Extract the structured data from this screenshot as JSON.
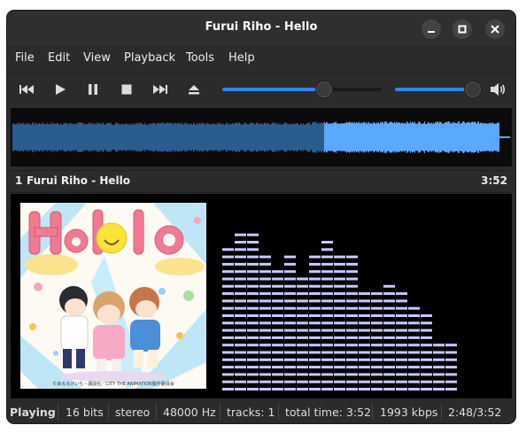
{
  "window": {
    "title": "Furui Riho - Hello"
  },
  "menu": [
    "File",
    "Edit",
    "View",
    "Playback",
    "Tools",
    "Help"
  ],
  "playback": {
    "seek_position": 0.64,
    "volume": 0.96
  },
  "track": {
    "number": "1",
    "name": "Furui Riho - Hello",
    "length": "3:52"
  },
  "album_art": {
    "caption": "©あるるけいち・講談社／CITY THE ANIMATION製作委員会"
  },
  "status": {
    "state": "Playing",
    "bits": "16 bits",
    "channels": "stereo",
    "rate": "48000 Hz",
    "tracks": "tracks: 1",
    "total": "total time: 3:52",
    "bitrate": "1993 kbps",
    "position": "2:48/3:52"
  },
  "colors": {
    "accent": "#3584e4",
    "waveform_played": "#5aa8ff",
    "waveform_remaining": "#2b5c8e",
    "spectrum_bar": "#c8c8ff"
  },
  "spectrum_levels": [
    20,
    22,
    22,
    19,
    17,
    19,
    16,
    19,
    21,
    19,
    19,
    14,
    14,
    15,
    14,
    12,
    11,
    7,
    7
  ]
}
